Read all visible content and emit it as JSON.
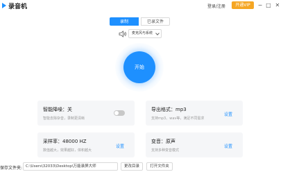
{
  "window": {
    "title": "录音机",
    "login_link": "登录/注册",
    "vip_button": "开通VIP",
    "min_glyph": "−",
    "max_glyph": "□",
    "close_glyph": "✕"
  },
  "tabs": [
    {
      "label": "录制",
      "active": true
    },
    {
      "label": "已录文件",
      "active": false
    }
  ],
  "audio_source": {
    "selected": "麦克风与系统"
  },
  "start_button": {
    "label": "开始"
  },
  "settings": {
    "noise_reduction": {
      "title": "智能降噪：关",
      "desc": "智能去除杂音，录制更清晰",
      "enabled": false
    },
    "output_format": {
      "title": "导出格式：mp3",
      "desc": "支持mp3、wav等，满足不同需求",
      "action": "设置"
    },
    "sample_rate": {
      "title": "采样率：48000 HZ",
      "desc": "数值越大，效果越好，体积越大",
      "action": "设置"
    },
    "voice_change": {
      "title": "变音：原声",
      "desc": "支持多种变音模式",
      "action": "设置"
    }
  },
  "save": {
    "label": "保存文件夹:",
    "path": "C:\\Users\\32033\\Desktop\\万能录屏大师",
    "change_button": "更改目录",
    "open_button": "打开文件夹"
  },
  "colors": {
    "accent": "#1e90ff",
    "vip": "#f5a623"
  }
}
